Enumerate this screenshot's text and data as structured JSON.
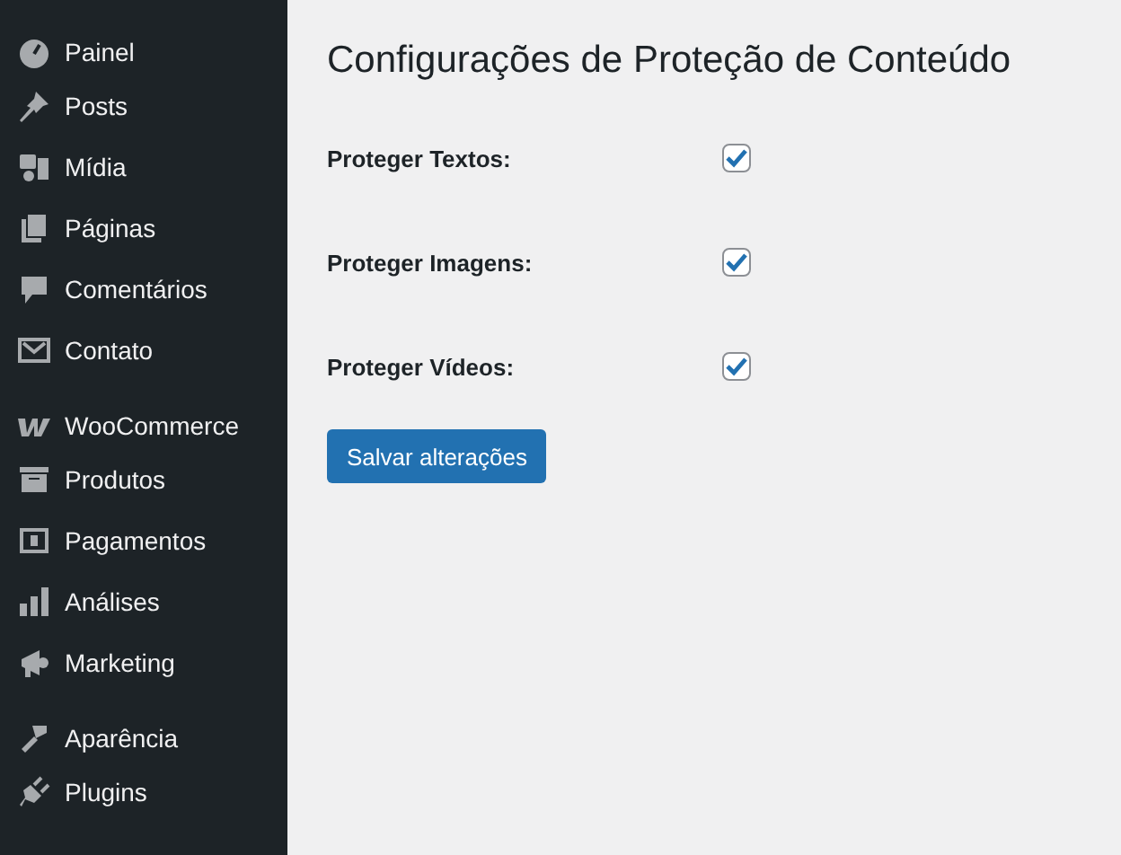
{
  "sidebar": {
    "sections": [
      [
        {
          "label": "Painel"
        },
        {
          "label": "Posts"
        },
        {
          "label": "Mídia"
        },
        {
          "label": "Páginas"
        },
        {
          "label": "Comentários"
        },
        {
          "label": "Contato"
        }
      ],
      [
        {
          "label": "WooCommerce"
        },
        {
          "label": "Produtos"
        },
        {
          "label": "Pagamentos"
        },
        {
          "label": "Análises"
        },
        {
          "label": "Marketing"
        }
      ],
      [
        {
          "label": "Aparência"
        },
        {
          "label": "Plugins"
        }
      ]
    ]
  },
  "page": {
    "title": "Configurações de Proteção de Conteúdo",
    "options": [
      {
        "label": "Proteger Textos:",
        "checked": true
      },
      {
        "label": "Proteger Imagens:",
        "checked": true
      },
      {
        "label": "Proteger Vídeos:",
        "checked": true
      }
    ],
    "save_button": "Salvar alterações"
  }
}
